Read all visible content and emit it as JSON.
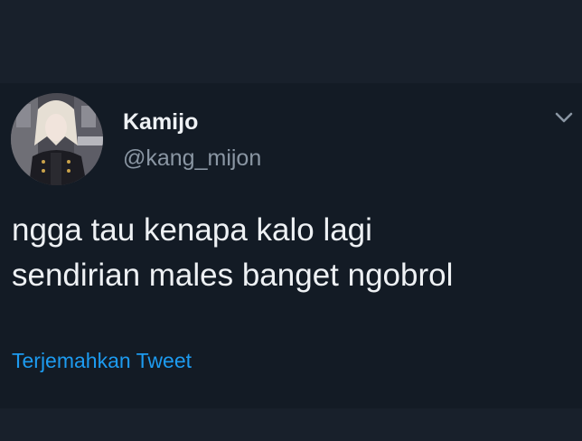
{
  "tweet": {
    "author": {
      "display_name": "Kamijo",
      "handle": "@kang_mijon",
      "avatar": "avatar-photo"
    },
    "text_lines": [
      "ngga tau kenapa kalo lagi",
      "sendirian males banget ngobrol"
    ],
    "translate_label": "Terjemahkan Tweet",
    "menu_icon": "chevron-down-icon"
  },
  "colors": {
    "background": "#141c26",
    "text_primary": "#eef1f4",
    "text_secondary": "#8a96a3",
    "link": "#1d9bf0"
  }
}
